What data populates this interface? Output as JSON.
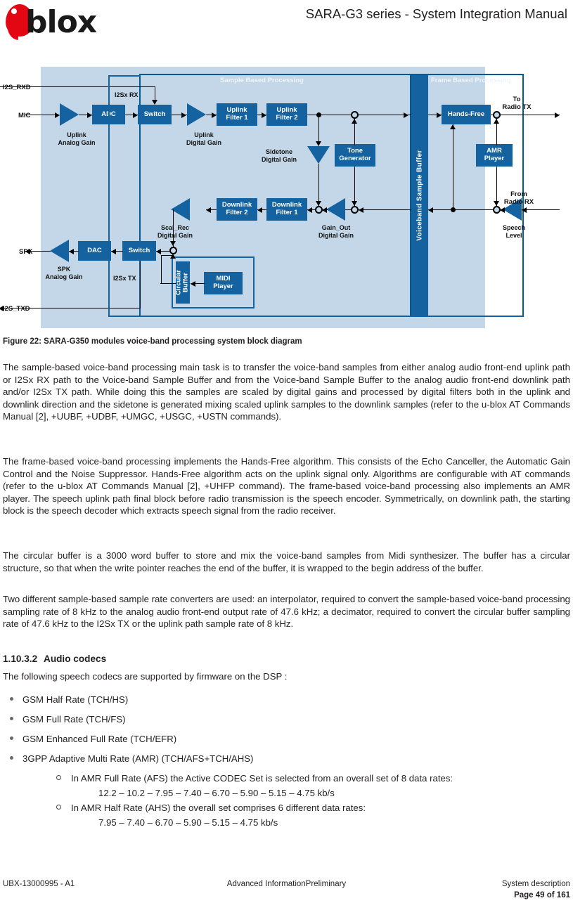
{
  "header": {
    "brand": "blox",
    "title": "SARA-G3 series - System Integration Manual"
  },
  "figure": {
    "caption": "Figure 22: SARA-G350 modules voice-band processing system block diagram",
    "section_labels": {
      "sample_based": "Sample Based Processing",
      "frame_based": "Frame Based Processing"
    },
    "voiceband_buffer": "Voiceband Sample Buffer",
    "ports": {
      "i2s_rxd": "I2S_RXD",
      "mic": "MIC",
      "spk": "SPK",
      "i2s_txd": "I2S_TXD",
      "to_radio_tx_1": "To",
      "to_radio_tx_2": "Radio TX",
      "from_radio_rx_1": "From",
      "from_radio_rx_2": "Radio RX"
    },
    "blocks": {
      "adc": "ADC",
      "switch_up": "Switch",
      "uplink_filter_1a": "Uplink",
      "uplink_filter_1b": "Filter 1",
      "uplink_filter_2a": "Uplink",
      "uplink_filter_2b": "Filter 2",
      "tone_gen_a": "Tone",
      "tone_gen_b": "Generator",
      "hands_free": "Hands-Free",
      "amr_player_a": "AMR",
      "amr_player_b": "Player",
      "downlink_filter_1a": "Downlink",
      "downlink_filter_1b": "Filter 1",
      "downlink_filter_2a": "Downlink",
      "downlink_filter_2b": "Filter 2",
      "dac": "DAC",
      "switch_down": "Switch",
      "midi_player_a": "MIDI",
      "midi_player_b": "Player",
      "circular_buffer": "Circular\nBuffer"
    },
    "labels": {
      "i2sx_rx": "I2Sx RX",
      "i2sx_tx": "I2Sx TX",
      "uplink_analog_gain_a": "Uplink",
      "uplink_analog_gain_b": "Analog Gain",
      "uplink_digital_gain_a": "Uplink",
      "uplink_digital_gain_b": "Digital Gain",
      "sidetone_digital_gain_a": "Sidetone",
      "sidetone_digital_gain_b": "Digital Gain",
      "gain_out_a": "Gain_Out",
      "gain_out_b": "Digital Gain",
      "speech_level_a": "Speech",
      "speech_level_b": "Level",
      "scal_rec_a": "Scal_Rec",
      "scal_rec_b": "Digital Gain",
      "spk_analog_gain_a": "SPK",
      "spk_analog_gain_b": "Analog Gain"
    },
    "colors": {
      "block_blue": "#1463a0",
      "panel_blue": "#c3d7e8",
      "border_blue": "#005b96"
    }
  },
  "body": {
    "p1": "The sample-based voice-band processing main task is to transfer the voice-band samples from either analog audio front-end uplink path or I2Sx RX path to the Voice-band Sample Buffer and from the Voice-band Sample Buffer to the analog audio front-end downlink path and/or I2Sx TX path. While doing this the samples are scaled by digital gains and processed by digital filters both in the uplink and downlink direction and the sidetone is generated mixing scaled uplink samples to the downlink samples (refer to the u-blox AT Commands Manual [2], +UUBF, +UDBF, +UMGC, +USGC, +USTN commands).",
    "p2": "The frame-based voice-band processing implements the Hands-Free algorithm. This consists of the Echo Canceller, the Automatic Gain Control and the Noise Suppressor. Hands-Free algorithm acts on the uplink signal only. Algorithms are configurable with AT commands (refer to the u-blox AT Commands Manual [2], +UHFP command). The frame-based voice-band processing also implements an AMR player. The speech uplink path final block before radio transmission is the speech encoder. Symmetrically, on downlink path, the starting block is the speech decoder which extracts speech signal from the radio receiver.",
    "p3": "The circular buffer is a 3000 word buffer to store and mix the voice-band samples from Midi synthesizer. The buffer has a circular structure, so that when the write pointer reaches the end of the buffer, it is wrapped to the begin address of the buffer.",
    "p4": "Two different sample-based sample rate converters are used: an interpolator, required to convert the sample-based voice-band processing sampling rate of 8 kHz to the analog audio front-end output rate of 47.6 kHz; a decimator, required to convert the circular buffer sampling rate of 47.6 kHz to the I2Sx TX or the uplink path sample rate of 8 kHz."
  },
  "section": {
    "number": "1.10.3.2",
    "title": "Audio codecs",
    "lead": "The following speech codecs are supported by firmware on the DSP :",
    "bullets": [
      "GSM Half Rate (TCH/HS)",
      "GSM Full Rate (TCH/FS)",
      "GSM Enhanced Full Rate (TCH/EFR)",
      "3GPP Adaptive Multi Rate (AMR) (TCH/AFS+TCH/AHS)"
    ],
    "sub_items": [
      {
        "text": "In AMR Full Rate (AFS) the Active CODEC Set is selected from an overall set of 8 data rates:",
        "rates": "12.2 – 10.2 – 7.95 – 7.40 – 6.70 – 5.90 – 5.15 – 4.75 kb/s"
      },
      {
        "text": "In AMR Half Rate (AHS) the overall set comprises 6 different data rates:",
        "rates": "7.95 – 7.40 – 6.70 – 5.90 – 5.15 – 4.75 kb/s"
      }
    ]
  },
  "footer": {
    "left": "UBX-13000995 - A1",
    "middle": "Advanced InformationPreliminary",
    "right": "System description",
    "page": "Page 49 of 161"
  }
}
